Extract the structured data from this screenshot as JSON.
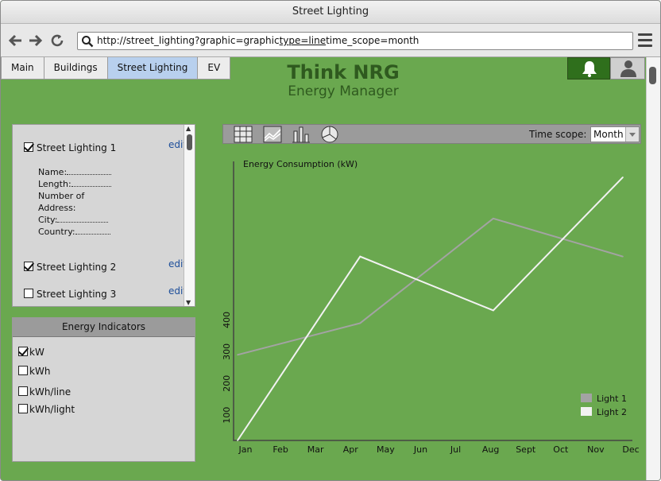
{
  "window": {
    "title": "Street Lighting"
  },
  "browser": {
    "url_before": "http://street_lighting?graphic=graphic",
    "url_underlined": "type=line",
    "url_after": "time_scope=month"
  },
  "tabs": [
    {
      "label": "Main",
      "active": false
    },
    {
      "label": "Buildings",
      "active": false
    },
    {
      "label": "Street Lighting",
      "active": true
    },
    {
      "label": "EV",
      "active": false
    }
  ],
  "brand": {
    "title": "Think NRG",
    "subtitle": "Energy Manager"
  },
  "top_icons": [
    "bell-icon",
    "user-icon"
  ],
  "lights": {
    "items": [
      {
        "label": "Street Lighting 1",
        "checked": true,
        "edit": "edit"
      },
      {
        "label": "Street Lighting 2",
        "checked": true,
        "edit": "edit"
      },
      {
        "label": "Street Lighting 3",
        "checked": false,
        "edit": "edit"
      }
    ],
    "details": [
      "Name:",
      "Length:",
      "Number of",
      "Address:",
      "City:",
      "Country:"
    ]
  },
  "energy_indicators": {
    "title": "Energy Indicators",
    "items": [
      {
        "label": "kW",
        "checked": true
      },
      {
        "label": "kWh",
        "checked": false
      },
      {
        "label": "kWh/line",
        "checked": false
      },
      {
        "label": "kWh/light",
        "checked": false
      }
    ]
  },
  "chart_toolbar": {
    "icons": [
      "table-icon",
      "line-chart-icon",
      "bar-chart-icon",
      "pie-chart-icon"
    ],
    "time_scope_label": "Time scope:",
    "time_scope_value": "Month"
  },
  "chart_data": {
    "type": "line",
    "title": "Energy Consumption (kW)",
    "x": [
      "Jan",
      "Feb",
      "Mar",
      "Apr",
      "May",
      "Jun",
      "Jul",
      "Aug",
      "Sept",
      "Oct",
      "Nov",
      "Dec"
    ],
    "yticks": [
      100,
      200,
      300,
      400
    ],
    "ylim": [
      20,
      900
    ],
    "grid": false,
    "legend_position": "bottom-right",
    "series": [
      {
        "name": "Light 1",
        "color": "#a3a3a3",
        "x_index": [
          0,
          3.5,
          7.3,
          11
        ],
        "values": [
          290,
          390,
          720,
          600
        ]
      },
      {
        "name": "Light 2",
        "color": "#f2f2f2",
        "x_index": [
          0,
          3.5,
          7.3,
          11
        ],
        "values": [
          20,
          600,
          430,
          850
        ]
      }
    ]
  }
}
